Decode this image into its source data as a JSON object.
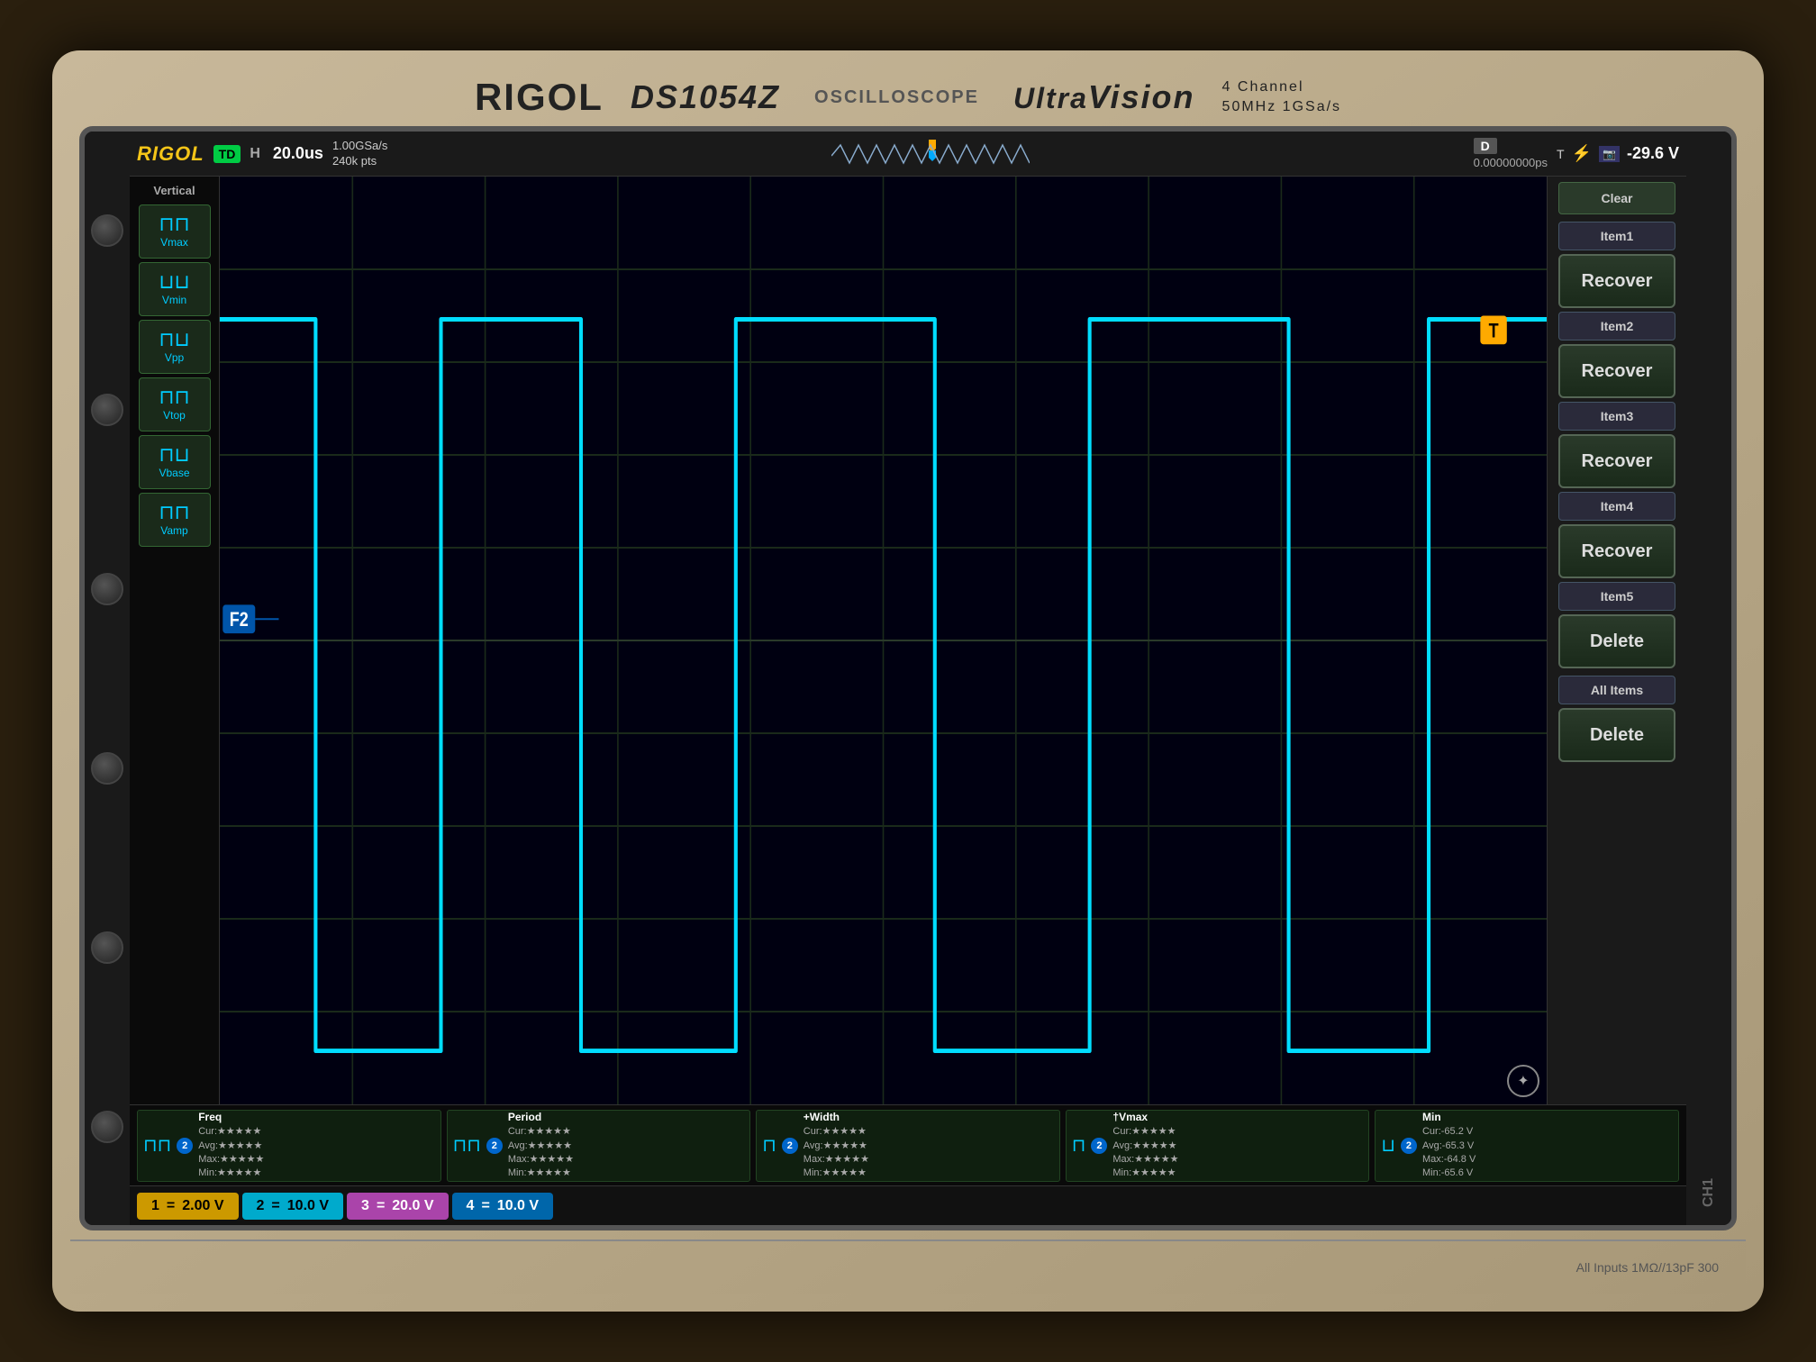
{
  "oscilloscope": {
    "brand": "RIGOL",
    "model": "DS1054Z",
    "type": "OSCILLOSCOPE",
    "vision_brand": "UltraVision",
    "specs_line1": "4 Channel",
    "specs_line2": "50MHz  1GSa/s",
    "top_bar": {
      "logo": "RIGOL",
      "mode": "TD",
      "h_label": "H",
      "timescale": "20.0us",
      "sample_rate": "1.00GSa/s",
      "pts": "240k pts",
      "d_label": "D",
      "timestamp": "0.00000000ps",
      "t_badge": "T",
      "icons": [
        "f",
        "camera"
      ],
      "voltage": "-29.6 V"
    },
    "vertical": {
      "label": "Vertical",
      "buttons": [
        {
          "icon": "⊓⊓",
          "label": "Vmax"
        },
        {
          "icon": "⊓⊓",
          "label": "Vmin"
        },
        {
          "icon": "⊓⊓",
          "label": "Vpp"
        },
        {
          "icon": "⊓⊓",
          "label": "Vtop"
        },
        {
          "icon": "⊓⊓",
          "label": "Vbase"
        },
        {
          "icon": "⊓⊓",
          "label": "Vamp"
        }
      ]
    },
    "right_panel": {
      "clear_label": "Clear",
      "items": [
        {
          "label": "Item1",
          "action": "Recover"
        },
        {
          "label": "Item2",
          "action": "Recover"
        },
        {
          "label": "Item3",
          "action": "Recover"
        },
        {
          "label": "Item4",
          "action": "Recover"
        },
        {
          "label": "Item5",
          "action": "Delete"
        }
      ],
      "all_items_label": "All Items",
      "all_items_action": "Delete"
    },
    "measurements": [
      {
        "title": "Freq",
        "ch": "2",
        "cur": "Cur:★★★★★",
        "avg": "Avg:★★★★★",
        "max": "Max:★★★★★",
        "min": "Min:★★★★★"
      },
      {
        "title": "Period",
        "ch": "2",
        "cur": "Cur:★★★★★",
        "avg": "Avg:★★★★★",
        "max": "Max:★★★★★",
        "min": "Min:★★★★★"
      },
      {
        "title": "+Width",
        "ch": "2",
        "cur": "Cur:★★★★★",
        "avg": "Avg:★★★★★",
        "max": "Max:★★★★★",
        "min": "Min:★★★★★"
      },
      {
        "title": "†Vmax",
        "ch": "2",
        "cur": "Cur:★★★★★",
        "avg": "Avg:★★★★★",
        "max": "Max:★★★★★",
        "min": "Min:★★★★★"
      },
      {
        "title": "Min",
        "ch": "2",
        "cur": "Cur:-65.2 V",
        "avg": "Avg:-65.3 V",
        "max": "Max:-64.8 V",
        "min": "Min:-65.6 V"
      }
    ],
    "channels": [
      {
        "num": "1",
        "voltage": "2.00 V",
        "color": "ch1"
      },
      {
        "num": "2",
        "voltage": "10.0 V",
        "color": "ch2"
      },
      {
        "num": "3",
        "voltage": "20.0 V",
        "color": "ch3"
      },
      {
        "num": "4",
        "voltage": "10.0 V",
        "color": "ch4"
      }
    ],
    "bottom_text": "All Inputs 1MΩ//13pF 300",
    "ch1_label": "CH1"
  }
}
